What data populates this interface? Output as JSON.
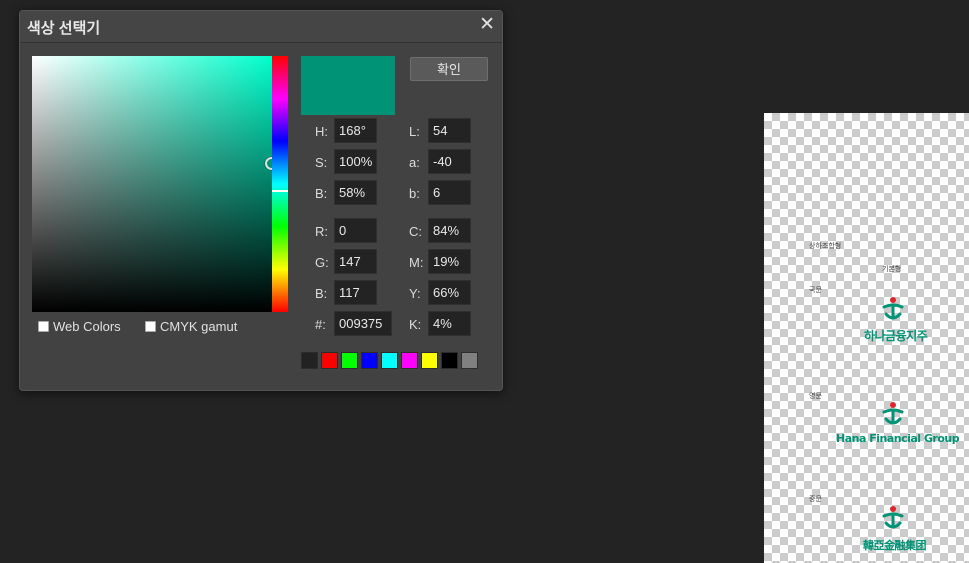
{
  "dialog": {
    "title": "색상 선택기",
    "close_glyph": "✕",
    "ok_label": "확인",
    "current_color": "#009375",
    "hsb": {
      "h_label": "H:",
      "h_value": "168°",
      "s_label": "S:",
      "s_value": "100%",
      "b_label": "B:",
      "b_value": "58%"
    },
    "lab": {
      "l_label": "L:",
      "l_value": "54",
      "a_label": "a:",
      "a_value": "-40",
      "b_label": "b:",
      "b_value": "6"
    },
    "rgb": {
      "r_label": "R:",
      "r_value": "0",
      "g_label": "G:",
      "g_value": "147",
      "b_label": "B:",
      "b_value": "117"
    },
    "cmyk": {
      "c_label": "C:",
      "c_value": "84%",
      "m_label": "M:",
      "m_value": "19%",
      "y_label": "Y:",
      "y_value": "66%",
      "k_label": "K:",
      "k_value": "4%"
    },
    "hex": {
      "label": "#:",
      "value": "009375"
    },
    "checkboxes": {
      "web_colors": "Web Colors",
      "cmyk_gamut": "CMYK gamut"
    },
    "swatches": [
      "#222222",
      "#ff0000",
      "#00ff00",
      "#0000ff",
      "#00ffff",
      "#ff00ff",
      "#ffff00",
      "#000000",
      "#808080"
    ]
  },
  "canvas": {
    "labels": {
      "label_1": "상하조합형",
      "label_2": "기본형",
      "label_3": "국문",
      "label_4": "영문",
      "label_5": "중문"
    },
    "logos": {
      "korean": "하나금융지주",
      "english": "Hana Financial Group",
      "chinese": "韓亞金融集团"
    },
    "brand_color": "#009375",
    "accent_color": "#e0262c"
  }
}
